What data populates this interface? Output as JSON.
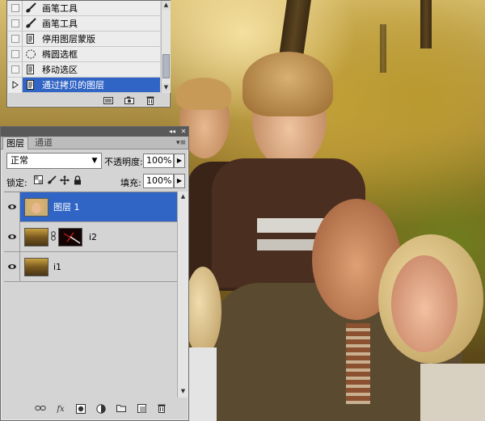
{
  "history": {
    "items": [
      {
        "label": "画笔工具",
        "icon": "brush-icon",
        "selected": false
      },
      {
        "label": "画笔工具",
        "icon": "brush-icon",
        "selected": false
      },
      {
        "label": "停用图层蒙版",
        "icon": "document-icon",
        "selected": false
      },
      {
        "label": "椭圆选框",
        "icon": "ellipse-marquee-icon",
        "selected": false
      },
      {
        "label": "移动选区",
        "icon": "document-icon",
        "selected": false
      },
      {
        "label": "通过拷贝的图层",
        "icon": "document-icon",
        "selected": true
      }
    ],
    "footer_icons": [
      "new-document-from-state-icon",
      "new-snapshot-icon",
      "delete-state-icon"
    ]
  },
  "layers_panel": {
    "tabs": [
      {
        "label": "图层",
        "active": true
      },
      {
        "label": "通道",
        "active": false
      }
    ],
    "blend_mode": "正常",
    "opacity_label": "不透明度:",
    "opacity_value": "100%",
    "lock_label": "锁定:",
    "fill_label": "填充:",
    "fill_value": "100%",
    "layers": [
      {
        "name": "图层 1",
        "selected": true,
        "has_mask": false
      },
      {
        "name": "i2",
        "selected": false,
        "has_mask": true
      },
      {
        "name": "i1",
        "selected": false,
        "has_mask": false
      }
    ],
    "footer_icons": [
      "link-layers-icon",
      "fx-icon",
      "add-mask-icon",
      "adjustment-layer-icon",
      "new-group-icon",
      "new-layer-icon",
      "delete-layer-icon"
    ]
  },
  "colors": {
    "selection_blue": "#3165c5",
    "panel_gray": "#d4d4d4"
  }
}
